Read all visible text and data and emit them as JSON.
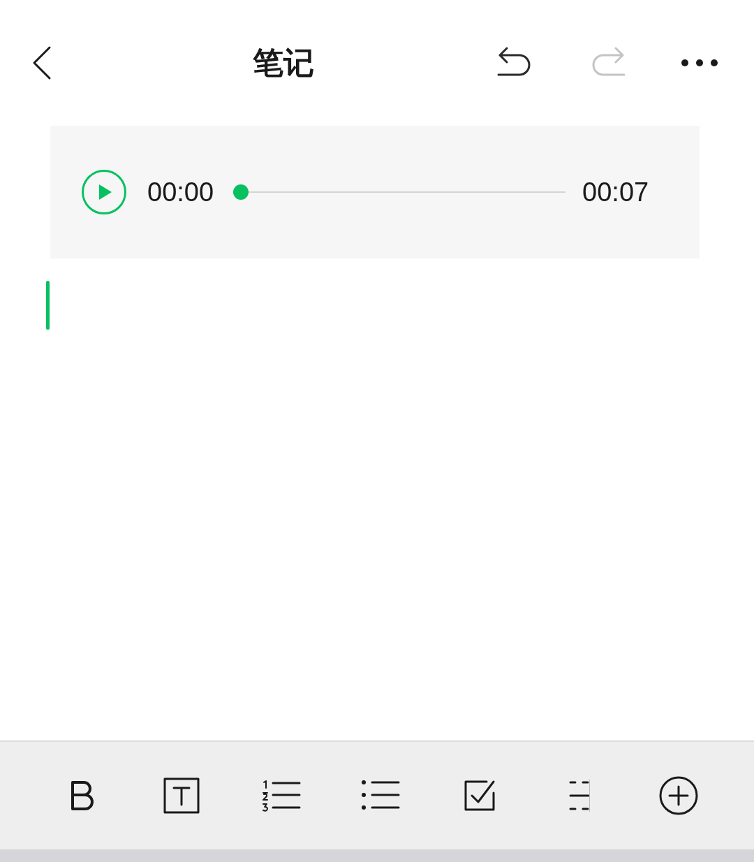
{
  "header": {
    "title": "笔记",
    "undo": {
      "disabled": false
    },
    "redo": {
      "disabled": true
    }
  },
  "audio": {
    "playing": false,
    "current": "00:00",
    "total": "00:07",
    "level": 0
  },
  "editor": {
    "focused": true
  },
  "toolbar": [
    {
      "kind": "bold"
    },
    {
      "kind": "text-style"
    },
    {
      "kind": "ordered-list"
    },
    {
      "kind": "bullet-list"
    },
    {
      "kind": "checklist"
    },
    {
      "kind": "divider"
    },
    {
      "kind": "insert"
    }
  ]
}
